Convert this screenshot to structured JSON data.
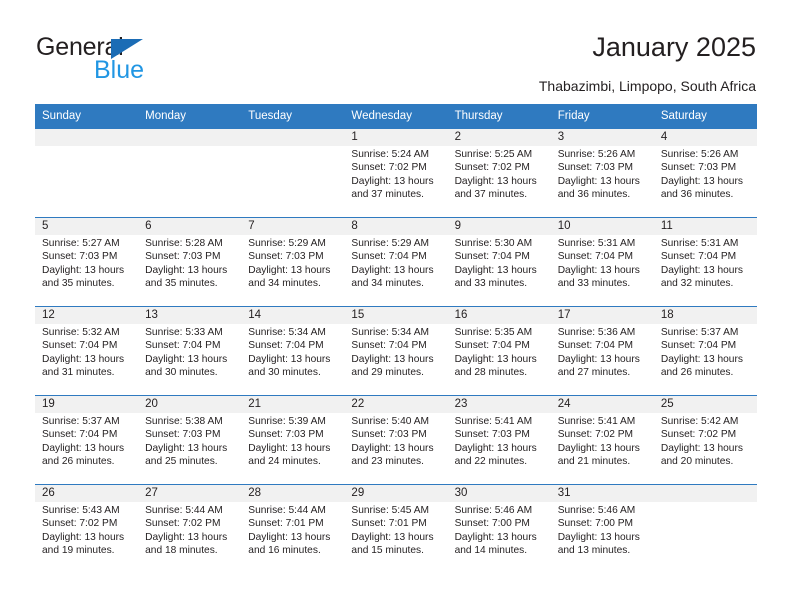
{
  "brand": {
    "name_part1": "General",
    "name_part2": "Blue",
    "triangle_color": "#1b6cb5",
    "blue_text_color": "#2196e3"
  },
  "header": {
    "title": "January 2025",
    "subtitle": "Thabazimbi, Limpopo, South Africa"
  },
  "theme": {
    "header_bg": "#2f7ac0",
    "daynum_bg": "#f1f1f1",
    "text": "#231f20"
  },
  "weekdays": [
    "Sunday",
    "Monday",
    "Tuesday",
    "Wednesday",
    "Thursday",
    "Friday",
    "Saturday"
  ],
  "labels": {
    "sunrise_prefix": "Sunrise: ",
    "sunset_prefix": "Sunset: ",
    "daylight_prefix": "Daylight: "
  },
  "weeks": [
    [
      {
        "day": ""
      },
      {
        "day": ""
      },
      {
        "day": ""
      },
      {
        "day": "1",
        "sunrise": "Sunrise: 5:24 AM",
        "sunset": "Sunset: 7:02 PM",
        "daylight": "Daylight: 13 hours and 37 minutes."
      },
      {
        "day": "2",
        "sunrise": "Sunrise: 5:25 AM",
        "sunset": "Sunset: 7:02 PM",
        "daylight": "Daylight: 13 hours and 37 minutes."
      },
      {
        "day": "3",
        "sunrise": "Sunrise: 5:26 AM",
        "sunset": "Sunset: 7:03 PM",
        "daylight": "Daylight: 13 hours and 36 minutes."
      },
      {
        "day": "4",
        "sunrise": "Sunrise: 5:26 AM",
        "sunset": "Sunset: 7:03 PM",
        "daylight": "Daylight: 13 hours and 36 minutes."
      }
    ],
    [
      {
        "day": "5",
        "sunrise": "Sunrise: 5:27 AM",
        "sunset": "Sunset: 7:03 PM",
        "daylight": "Daylight: 13 hours and 35 minutes."
      },
      {
        "day": "6",
        "sunrise": "Sunrise: 5:28 AM",
        "sunset": "Sunset: 7:03 PM",
        "daylight": "Daylight: 13 hours and 35 minutes."
      },
      {
        "day": "7",
        "sunrise": "Sunrise: 5:29 AM",
        "sunset": "Sunset: 7:03 PM",
        "daylight": "Daylight: 13 hours and 34 minutes."
      },
      {
        "day": "8",
        "sunrise": "Sunrise: 5:29 AM",
        "sunset": "Sunset: 7:04 PM",
        "daylight": "Daylight: 13 hours and 34 minutes."
      },
      {
        "day": "9",
        "sunrise": "Sunrise: 5:30 AM",
        "sunset": "Sunset: 7:04 PM",
        "daylight": "Daylight: 13 hours and 33 minutes."
      },
      {
        "day": "10",
        "sunrise": "Sunrise: 5:31 AM",
        "sunset": "Sunset: 7:04 PM",
        "daylight": "Daylight: 13 hours and 33 minutes."
      },
      {
        "day": "11",
        "sunrise": "Sunrise: 5:31 AM",
        "sunset": "Sunset: 7:04 PM",
        "daylight": "Daylight: 13 hours and 32 minutes."
      }
    ],
    [
      {
        "day": "12",
        "sunrise": "Sunrise: 5:32 AM",
        "sunset": "Sunset: 7:04 PM",
        "daylight": "Daylight: 13 hours and 31 minutes."
      },
      {
        "day": "13",
        "sunrise": "Sunrise: 5:33 AM",
        "sunset": "Sunset: 7:04 PM",
        "daylight": "Daylight: 13 hours and 30 minutes."
      },
      {
        "day": "14",
        "sunrise": "Sunrise: 5:34 AM",
        "sunset": "Sunset: 7:04 PM",
        "daylight": "Daylight: 13 hours and 30 minutes."
      },
      {
        "day": "15",
        "sunrise": "Sunrise: 5:34 AM",
        "sunset": "Sunset: 7:04 PM",
        "daylight": "Daylight: 13 hours and 29 minutes."
      },
      {
        "day": "16",
        "sunrise": "Sunrise: 5:35 AM",
        "sunset": "Sunset: 7:04 PM",
        "daylight": "Daylight: 13 hours and 28 minutes."
      },
      {
        "day": "17",
        "sunrise": "Sunrise: 5:36 AM",
        "sunset": "Sunset: 7:04 PM",
        "daylight": "Daylight: 13 hours and 27 minutes."
      },
      {
        "day": "18",
        "sunrise": "Sunrise: 5:37 AM",
        "sunset": "Sunset: 7:04 PM",
        "daylight": "Daylight: 13 hours and 26 minutes."
      }
    ],
    [
      {
        "day": "19",
        "sunrise": "Sunrise: 5:37 AM",
        "sunset": "Sunset: 7:04 PM",
        "daylight": "Daylight: 13 hours and 26 minutes."
      },
      {
        "day": "20",
        "sunrise": "Sunrise: 5:38 AM",
        "sunset": "Sunset: 7:03 PM",
        "daylight": "Daylight: 13 hours and 25 minutes."
      },
      {
        "day": "21",
        "sunrise": "Sunrise: 5:39 AM",
        "sunset": "Sunset: 7:03 PM",
        "daylight": "Daylight: 13 hours and 24 minutes."
      },
      {
        "day": "22",
        "sunrise": "Sunrise: 5:40 AM",
        "sunset": "Sunset: 7:03 PM",
        "daylight": "Daylight: 13 hours and 23 minutes."
      },
      {
        "day": "23",
        "sunrise": "Sunrise: 5:41 AM",
        "sunset": "Sunset: 7:03 PM",
        "daylight": "Daylight: 13 hours and 22 minutes."
      },
      {
        "day": "24",
        "sunrise": "Sunrise: 5:41 AM",
        "sunset": "Sunset: 7:02 PM",
        "daylight": "Daylight: 13 hours and 21 minutes."
      },
      {
        "day": "25",
        "sunrise": "Sunrise: 5:42 AM",
        "sunset": "Sunset: 7:02 PM",
        "daylight": "Daylight: 13 hours and 20 minutes."
      }
    ],
    [
      {
        "day": "26",
        "sunrise": "Sunrise: 5:43 AM",
        "sunset": "Sunset: 7:02 PM",
        "daylight": "Daylight: 13 hours and 19 minutes."
      },
      {
        "day": "27",
        "sunrise": "Sunrise: 5:44 AM",
        "sunset": "Sunset: 7:02 PM",
        "daylight": "Daylight: 13 hours and 18 minutes."
      },
      {
        "day": "28",
        "sunrise": "Sunrise: 5:44 AM",
        "sunset": "Sunset: 7:01 PM",
        "daylight": "Daylight: 13 hours and 16 minutes."
      },
      {
        "day": "29",
        "sunrise": "Sunrise: 5:45 AM",
        "sunset": "Sunset: 7:01 PM",
        "daylight": "Daylight: 13 hours and 15 minutes."
      },
      {
        "day": "30",
        "sunrise": "Sunrise: 5:46 AM",
        "sunset": "Sunset: 7:00 PM",
        "daylight": "Daylight: 13 hours and 14 minutes."
      },
      {
        "day": "31",
        "sunrise": "Sunrise: 5:46 AM",
        "sunset": "Sunset: 7:00 PM",
        "daylight": "Daylight: 13 hours and 13 minutes."
      },
      {
        "day": ""
      }
    ]
  ]
}
